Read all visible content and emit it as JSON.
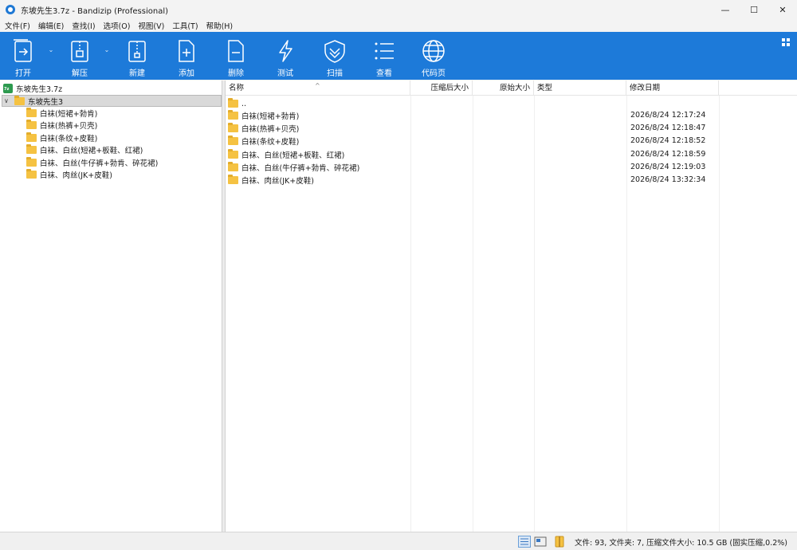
{
  "window": {
    "title": "东坡先生3.7z - Bandizip (Professional)",
    "minimize_glyph": "—",
    "maximize_glyph": "☐",
    "close_glyph": "✕"
  },
  "menu": [
    "文件(F)",
    "编辑(E)",
    "查找(I)",
    "选项(O)",
    "视图(V)",
    "工具(T)",
    "帮助(H)"
  ],
  "toolbar": {
    "open": "打开",
    "extract": "解压",
    "new": "新建",
    "add": "添加",
    "delete": "删除",
    "test": "测试",
    "scan": "扫描",
    "view": "查看",
    "codepage": "代码页",
    "dropdown_glyph": "⌄"
  },
  "tree": {
    "archive": "东坡先生3.7z",
    "root_folder": "东坡先生3",
    "expand_glyph": "∨",
    "children": [
      "白袜(短裙+勃肯)",
      "白袜(热裤+贝壳)",
      "白袜(条纹+皮鞋)",
      "白袜、白丝(短裙+板鞋、红裙)",
      "白袜、白丝(牛仔裤+勃肯、碎花裙)",
      "白袜、肉丝(JK+皮鞋)"
    ]
  },
  "list": {
    "columns": {
      "name": "名称",
      "packed": "压缩后大小",
      "original": "原始大小",
      "type": "类型",
      "modified": "修改日期"
    },
    "sort_glyph": "^",
    "parent": "..",
    "rows": [
      {
        "name": "白袜(短裙+勃肯)",
        "modified": "2026/8/24 12:17:24"
      },
      {
        "name": "白袜(热裤+贝壳)",
        "modified": "2026/8/24 12:18:47"
      },
      {
        "name": "白袜(条纹+皮鞋)",
        "modified": "2026/8/24 12:18:52"
      },
      {
        "name": "白袜、白丝(短裙+板鞋、红裙)",
        "modified": "2026/8/24 12:18:59"
      },
      {
        "name": "白袜、白丝(牛仔裤+勃肯、碎花裙)",
        "modified": "2026/8/24 12:19:03"
      },
      {
        "name": "白袜、肉丝(JK+皮鞋)",
        "modified": "2026/8/24 13:32:34"
      }
    ]
  },
  "status": {
    "summary": "文件: 93, 文件夹: 7, 压缩文件大小: 10.5 GB (固实压缩,0.2%)"
  },
  "colors": {
    "toolbar": "#1d7ad9",
    "folder": "#f5c242",
    "selection": "#d9d9d9"
  }
}
